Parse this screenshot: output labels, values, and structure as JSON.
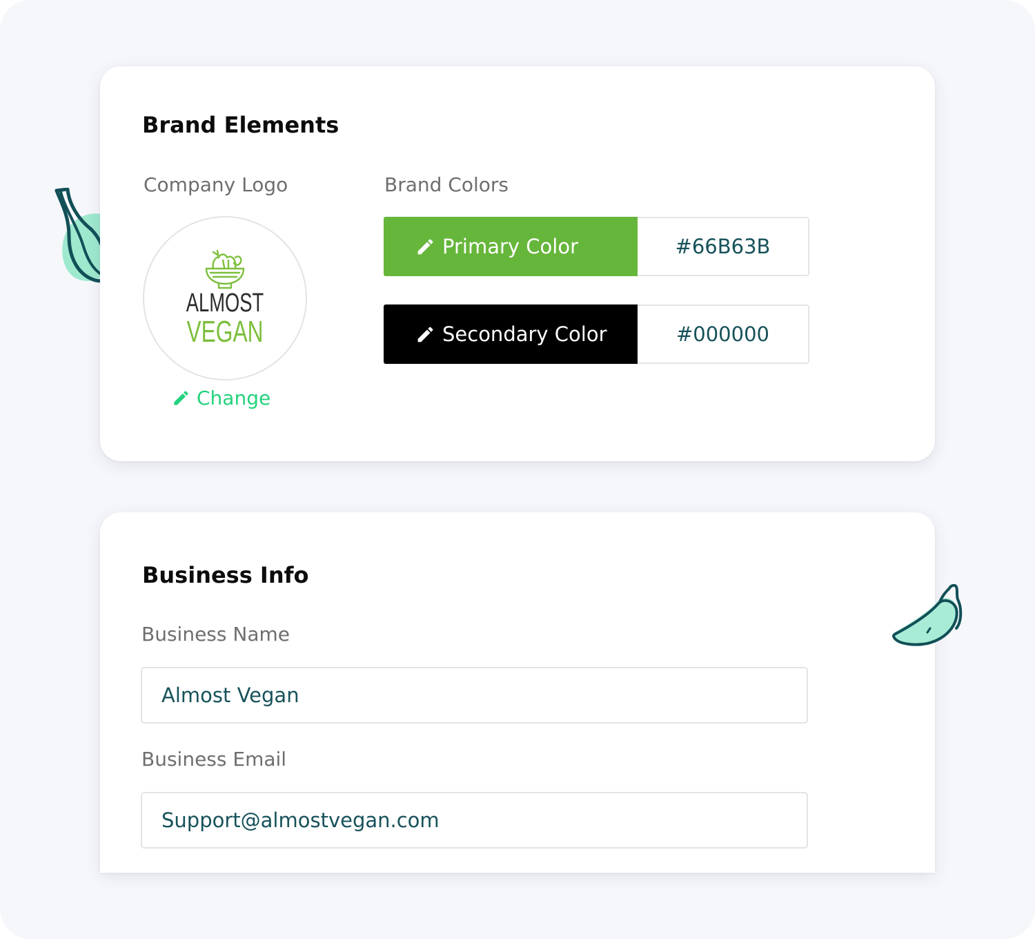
{
  "colors": {
    "page_background": "#f6f7fb",
    "card_background": "#ffffff",
    "accent_green": "#22d27c",
    "field_text": "#17525a",
    "primary_swatch": "#66B63B",
    "secondary_swatch": "#000000"
  },
  "brand_elements": {
    "title": "Brand Elements",
    "company_logo": {
      "label": "Company Logo",
      "logo_text_line1": "ALMOST",
      "logo_text_line2": "VEGAN",
      "change_label": "Change",
      "change_icon": "pencil-icon"
    },
    "brand_colors": {
      "label": "Brand Colors",
      "primary": {
        "label": "Primary Color",
        "value": "#66B63B",
        "icon": "pencil-icon"
      },
      "secondary": {
        "label": "Secondary Color",
        "value": "#000000",
        "icon": "pencil-icon"
      }
    }
  },
  "business_info": {
    "title": "Business Info",
    "name": {
      "label": "Business Name",
      "value": "Almost Vegan"
    },
    "email": {
      "label": "Business Email",
      "value": "Support@almostvegan.com"
    }
  },
  "decorations": [
    "garlic-illustration",
    "chili-pepper-illustration"
  ]
}
